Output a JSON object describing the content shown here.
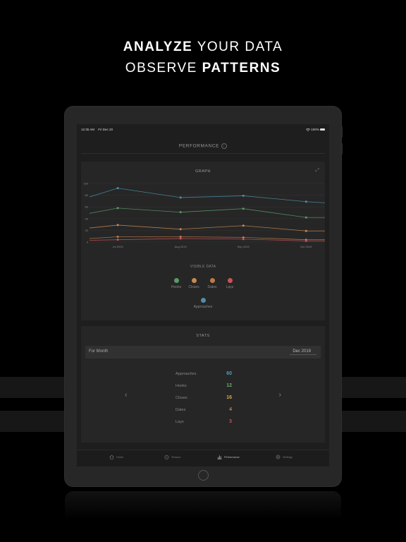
{
  "headline": {
    "line1_bold": "ANALYZE",
    "line1_rest": "YOUR DATA",
    "line2_rest": "OBSERVE",
    "line2_bold": "PATTERNS"
  },
  "status_bar": {
    "time": "12:35 AM",
    "date": "Fri Dec 20",
    "battery": "100%"
  },
  "nav": {
    "title": "PERFORMANCE",
    "info_icon": "info-icon"
  },
  "graph": {
    "title": "GRAPH",
    "expand_icon": "expand-icon",
    "visible_data_title": "VISIBLE DATA",
    "legend": [
      {
        "label": "Hooks",
        "color": "#5a9a66"
      },
      {
        "label": "Closes",
        "color": "#c98a50"
      },
      {
        "label": "Dates",
        "color": "#c07a48"
      },
      {
        "label": "Lays",
        "color": "#c9535a"
      },
      {
        "label": "Approaches",
        "color": "#4e90a8"
      }
    ]
  },
  "chart_data": {
    "type": "line",
    "categories": [
      "Jul 2019",
      "Aug 2019",
      "Sep 2019",
      "Oct 2019"
    ],
    "x": [
      -0.45,
      0,
      1,
      2,
      3,
      3.3
    ],
    "ylim": [
      0,
      100
    ],
    "yticks": [
      0,
      20,
      40,
      60,
      80,
      100
    ],
    "grid": true,
    "series": [
      {
        "name": "Approaches",
        "color": "#4e90a8",
        "values": [
          77,
          92,
          76,
          79,
          69,
          67
        ]
      },
      {
        "name": "Hooks",
        "color": "#5a9a66",
        "values": [
          49,
          58,
          51,
          57,
          42,
          42
        ]
      },
      {
        "name": "Closes",
        "color": "#c98a50",
        "values": [
          24,
          29,
          22,
          28,
          19,
          19
        ]
      },
      {
        "name": "Dates",
        "color": "#c07a48",
        "values": [
          6,
          9,
          9,
          8,
          4,
          4
        ]
      },
      {
        "name": "Lays",
        "color": "#c9535a",
        "values": [
          3,
          4,
          6,
          5,
          2,
          2
        ]
      }
    ]
  },
  "stats": {
    "title": "STATS",
    "period_label": "For Month",
    "period_value": "Dec 2019",
    "prev_arrow": "‹",
    "next_arrow": "›",
    "rows": [
      {
        "name": "Approaches",
        "value": "60",
        "color": "#4aa3b8"
      },
      {
        "name": "Hooks",
        "value": "12",
        "color": "#6aaa6a"
      },
      {
        "name": "Closes",
        "value": "16",
        "color": "#d3a45a"
      },
      {
        "name": "Dates",
        "value": "4",
        "color": "#c98040"
      },
      {
        "name": "Lays",
        "value": "3",
        "color": "#d05050"
      }
    ]
  },
  "tabs": [
    {
      "label": "Home",
      "icon": "home-icon"
    },
    {
      "label": "Session",
      "icon": "timer-icon"
    },
    {
      "label": "Performance",
      "icon": "bar-chart-icon",
      "active": true
    },
    {
      "label": "Settings",
      "icon": "gear-icon"
    }
  ]
}
